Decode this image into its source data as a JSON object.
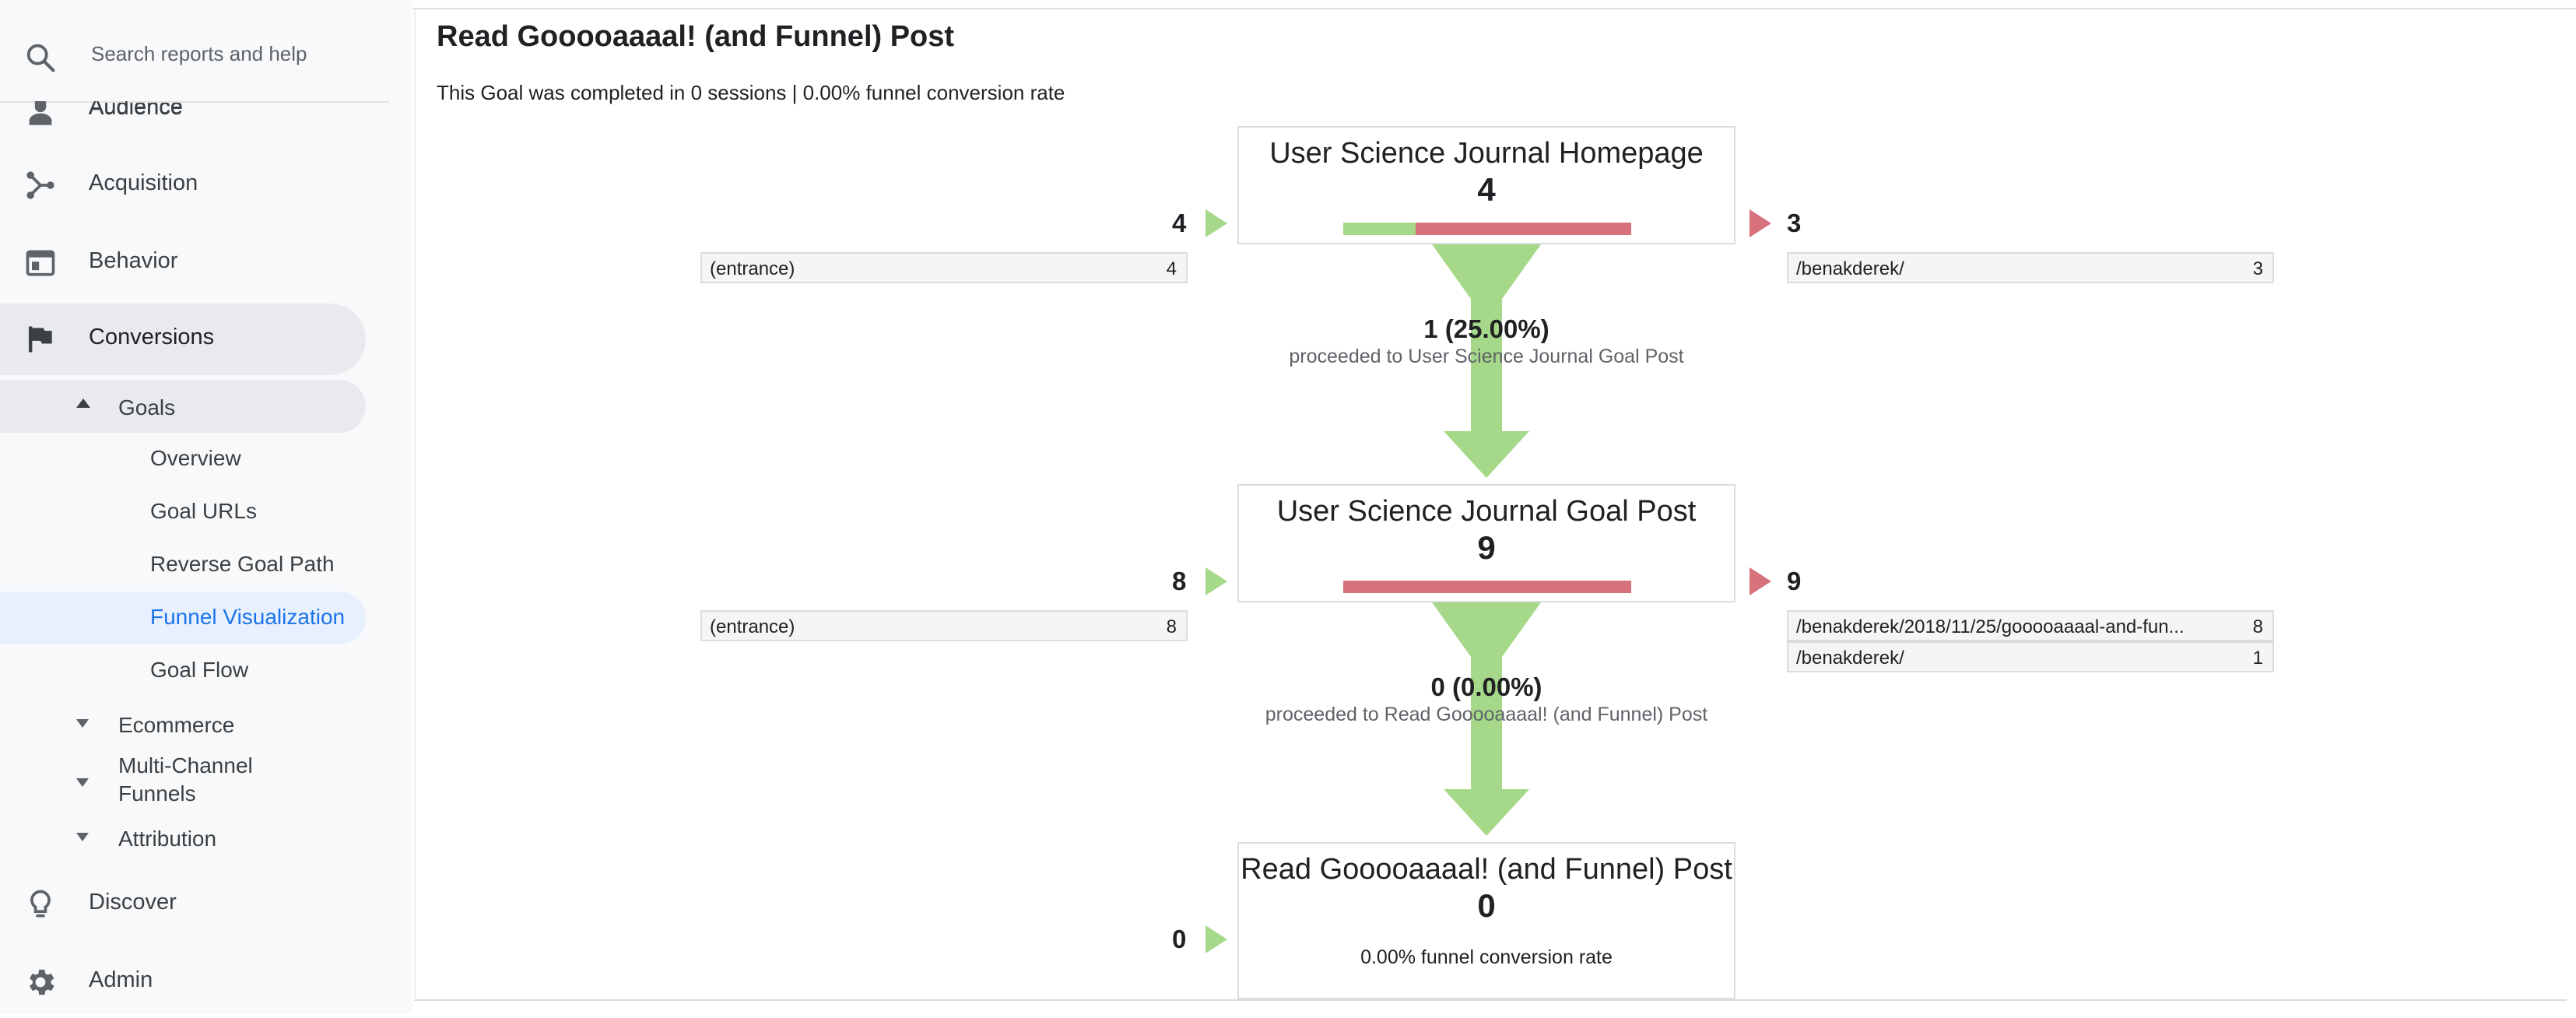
{
  "search": {
    "placeholder": "Search reports and help"
  },
  "sidebar": {
    "top_items": [
      {
        "label": "Audience",
        "icon": "person-icon"
      },
      {
        "label": "Acquisition",
        "icon": "acquisition-icon"
      },
      {
        "label": "Behavior",
        "icon": "behavior-icon"
      },
      {
        "label": "Conversions",
        "icon": "flag-icon"
      }
    ],
    "goals_label": "Goals",
    "goals_children": [
      "Overview",
      "Goal URLs",
      "Reverse Goal Path",
      "Funnel Visualization",
      "Goal Flow"
    ],
    "collapsed_sections": [
      "Ecommerce",
      "Multi-Channel Funnels",
      "Attribution"
    ],
    "bottom_items": [
      {
        "label": "Discover",
        "icon": "lightbulb-icon"
      },
      {
        "label": "Admin",
        "icon": "gear-icon"
      }
    ]
  },
  "page": {
    "title": "Read Gooooaaaal! (and Funnel) Post",
    "summary": "This Goal was completed in 0 sessions | 0.00% funnel conversion rate"
  },
  "funnel": {
    "steps": [
      {
        "name": "User Science Journal Homepage",
        "count": "4",
        "entries": "4",
        "exits": "3",
        "entry_rows": [
          {
            "label": "(entrance)",
            "value": "4"
          }
        ],
        "exit_rows": [
          {
            "label": "/benakderek/",
            "value": "3"
          }
        ],
        "proceeded_fraction": 0.25,
        "proceeded_count": "1 (25.00%)",
        "proceeded_label": "proceeded to User Science Journal Goal Post"
      },
      {
        "name": "User Science Journal Goal Post",
        "count": "9",
        "entries": "8",
        "exits": "9",
        "entry_rows": [
          {
            "label": "(entrance)",
            "value": "8"
          }
        ],
        "exit_rows": [
          {
            "label": "/benakderek/2018/11/25/gooooaaaal-and-fun...",
            "value": "8"
          },
          {
            "label": "/benakderek/",
            "value": "1"
          }
        ],
        "proceeded_fraction": 0.0,
        "proceeded_count": "0 (0.00%)",
        "proceeded_label": "proceeded to Read Gooooaaaal! (and Funnel) Post"
      },
      {
        "name": "Read Gooooaaaal! (and Funnel) Post",
        "count": "0",
        "entries": "0",
        "conversion_rate": "0.00% funnel conversion rate"
      }
    ]
  },
  "colors": {
    "green": "#a5d888",
    "red": "#d7717b",
    "selected": "#1a73e8"
  }
}
